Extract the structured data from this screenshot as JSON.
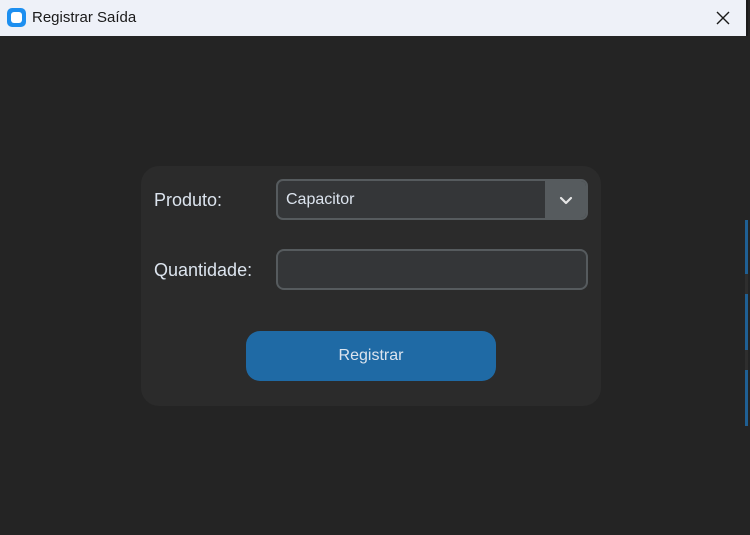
{
  "window": {
    "title": "Registrar Saída",
    "accent_color": "#1d8ff0"
  },
  "form": {
    "product_label": "Produto:",
    "product_selected": "Capacitor",
    "quantity_label": "Quantidade:",
    "quantity_value": "",
    "submit_label": "Registrar",
    "button_color": "#1f6aa5"
  },
  "icons": {
    "app": "app-icon",
    "close": "close-icon",
    "dropdown": "chevron-down-icon"
  }
}
